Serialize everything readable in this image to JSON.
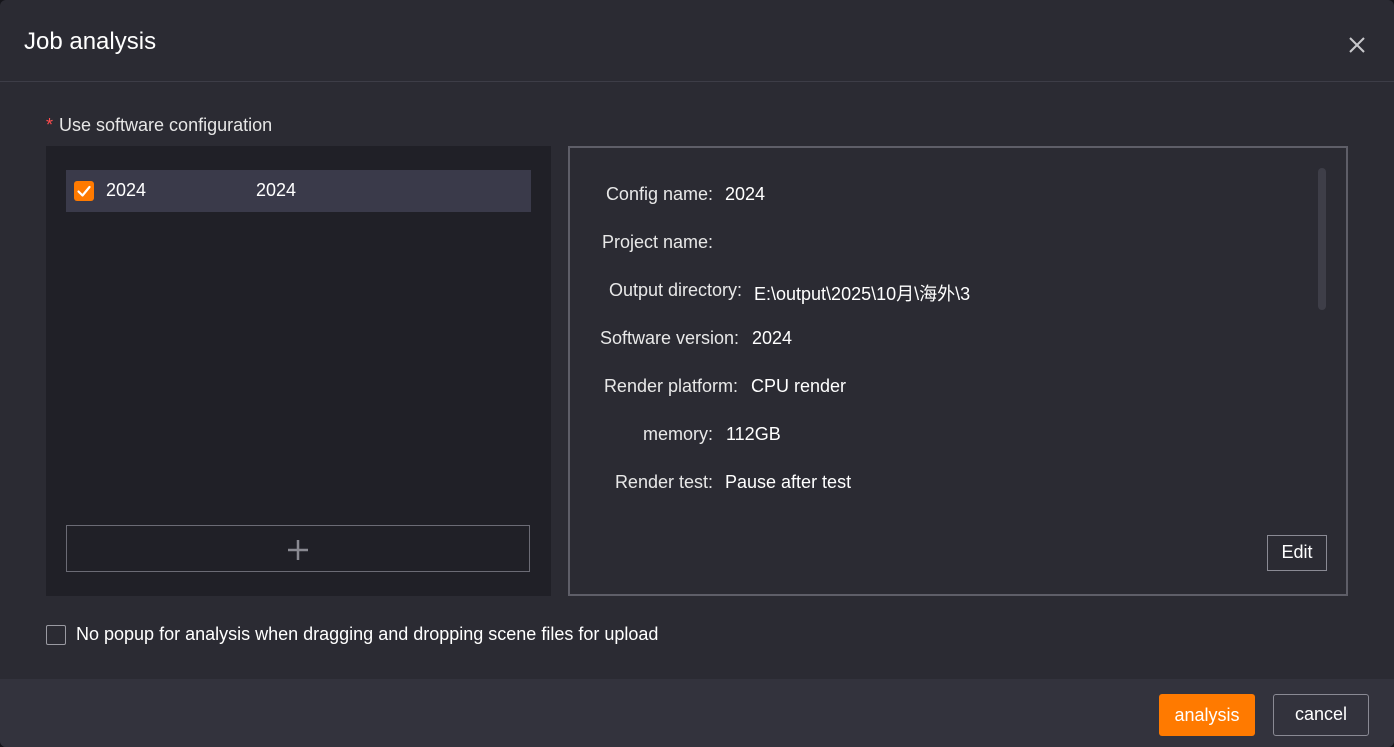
{
  "dialog": {
    "title": "Job analysis",
    "close_icon": "close-icon"
  },
  "section": {
    "required_mark": "*",
    "label": "Use software configuration"
  },
  "config_list": {
    "items": [
      {
        "checked": true,
        "name": "2024",
        "version": "2024"
      }
    ],
    "add_icon": "plus-icon"
  },
  "details": {
    "rows": [
      {
        "label": "Config name:",
        "value": "2024"
      },
      {
        "label": "Project name:",
        "value": ""
      },
      {
        "label": "Output directory:",
        "value": "E:\\output\\2025\\10月\\海外\\3"
      },
      {
        "label": "Software version:",
        "value": "2024"
      },
      {
        "label": "Render platform:",
        "value": "CPU render"
      },
      {
        "label": "memory:",
        "value": "112GB"
      },
      {
        "label": "Render test:",
        "value": "Pause after test"
      }
    ],
    "edit_label": "Edit"
  },
  "option": {
    "checked": false,
    "label": "No popup for analysis when dragging and dropping scene files for upload"
  },
  "footer": {
    "analysis_label": "analysis",
    "cancel_label": "cancel"
  },
  "colors": {
    "accent": "#ff7a00",
    "background": "#2b2b33",
    "required": "#ff4d4f"
  }
}
